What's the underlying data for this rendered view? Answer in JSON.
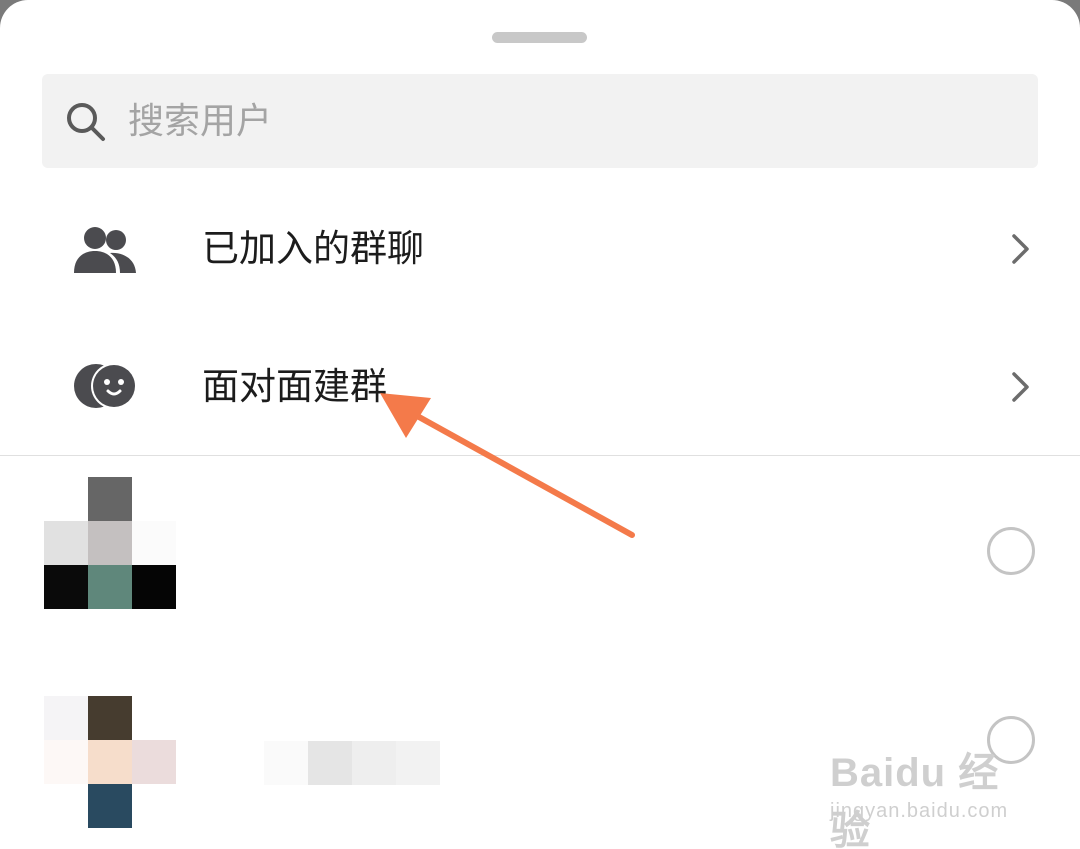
{
  "search": {
    "placeholder": "搜索用户"
  },
  "menu": [
    {
      "label": "已加入的群聊",
      "icon": "group-icon"
    },
    {
      "label": "面对面建群",
      "icon": "face-to-face-icon"
    }
  ],
  "contacts": [
    {
      "selected": false
    },
    {
      "selected": false
    }
  ],
  "watermark": {
    "brand": "Baidu 经验",
    "url": "jingyan.baidu.com"
  },
  "colors": {
    "arrow": "#f47a4a",
    "icon": "#4b4b4f",
    "divider": "#e0e0e0"
  }
}
